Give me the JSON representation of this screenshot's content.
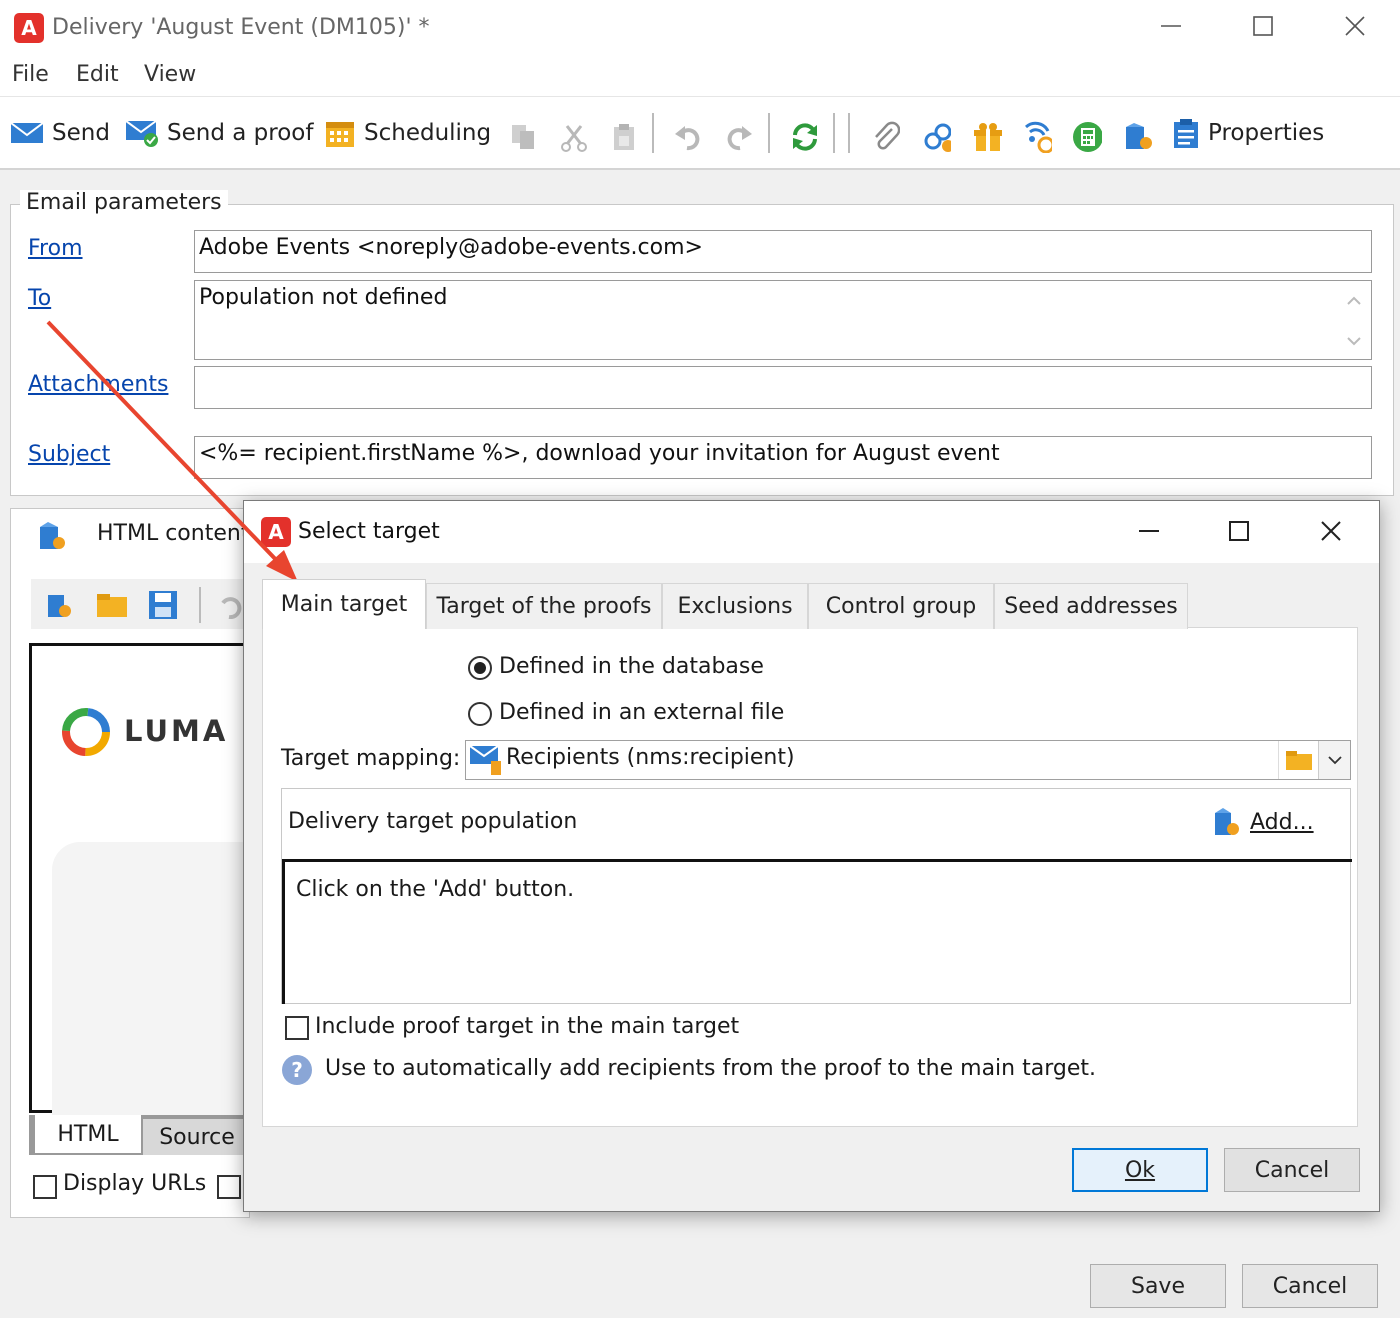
{
  "window": {
    "title": "Delivery 'August Event (DM105)' *",
    "logo": "A"
  },
  "menu": [
    "File",
    "Edit",
    "View"
  ],
  "toolbar": {
    "send": "Send",
    "send_proof": "Send a proof",
    "scheduling": "Scheduling",
    "properties": "Properties"
  },
  "email_params": {
    "legend": "Email parameters",
    "from_label": "From",
    "from_value": "Adobe Events <noreply@adobe-events.com>",
    "to_label": "To",
    "to_value": "Population not defined",
    "attachments_label": "Attachments",
    "attachments_value": "",
    "subject_label": "Subject",
    "subject_value": "<%= recipient.firstName %>, download your invitation for August event"
  },
  "content": {
    "header": "HTML content",
    "brand": "LUMA",
    "tab_html": "HTML",
    "tab_source": "Source",
    "display_urls": "Display URLs"
  },
  "main_buttons": {
    "save": "Save",
    "cancel": "Cancel"
  },
  "dialog": {
    "title": "Select target",
    "logo": "A",
    "tabs": [
      "Main target",
      "Target of the proofs",
      "Exclusions",
      "Control group",
      "Seed addresses"
    ],
    "radio_db": "Defined in the database",
    "radio_file": "Defined in an external file",
    "mapping_label": "Target mapping:",
    "mapping_value": "Recipients (nms:recipient)",
    "population_label": "Delivery target population",
    "add_label": "Add...",
    "population_hint": "Click on the 'Add' button.",
    "include_proof": "Include proof target in the main target",
    "help_text": "Use to automatically add recipients from the proof to the main target.",
    "ok": "Ok",
    "cancel": "Cancel"
  },
  "colors": {
    "accent": "#e3312b",
    "link": "#0645ad",
    "arrow": "#e8452f",
    "focus": "#0078d7"
  }
}
